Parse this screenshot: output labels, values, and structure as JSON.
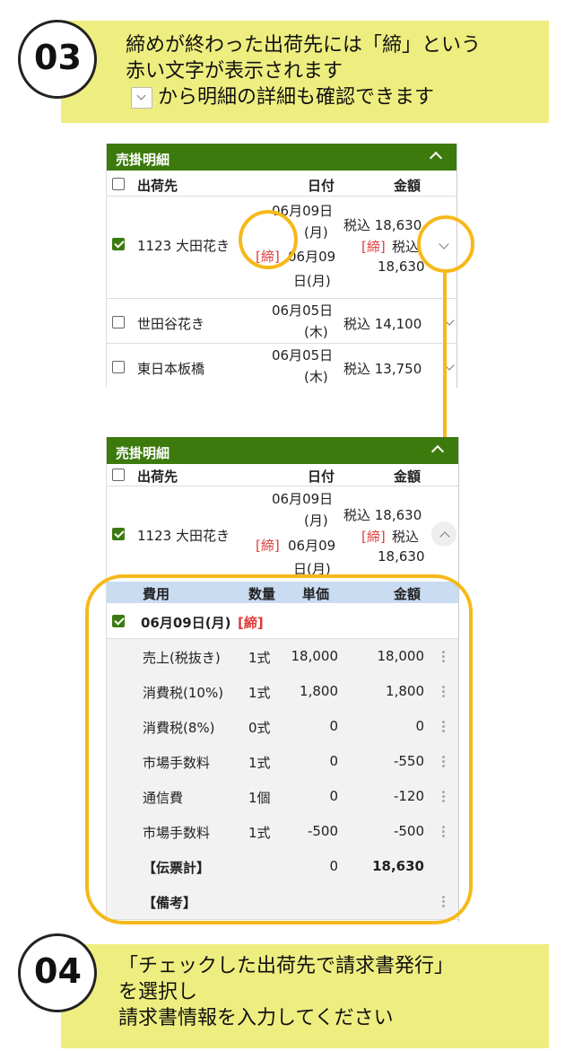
{
  "steps": {
    "step3": {
      "number": "03",
      "line1": "締めが終わった出荷先には「締」という",
      "line2": "赤い文字が表示されます",
      "line3": "から明細の詳細も確認できます"
    },
    "step4": {
      "number": "04",
      "line1": "「チェックした出荷先で請求書発行」",
      "line2": "を選択し",
      "line3": "請求書情報を入力してください"
    }
  },
  "panel": {
    "title": "売掛明細",
    "columns": {
      "destination": "出荷先",
      "date": "日付",
      "amount": "金額"
    },
    "rows": [
      {
        "name": "1123 大田花き",
        "date_line1": "06月09日",
        "date_line2": "(月)",
        "closed_tag": "[締]",
        "date_line3": "06月09",
        "date_line4": "日(月)",
        "amount_line1": "税込 18,630",
        "closed_tag2": "[締]",
        "amount_line2": "税込",
        "amount_line3": "18,630",
        "checked": true
      },
      {
        "name": "世田谷花き",
        "date_line1": "06月05日",
        "date_line2": "(木)",
        "amount_line1": "税込 14,100",
        "checked": false
      },
      {
        "name": "東日本板橋",
        "date_line1": "06月05日",
        "date_line2": "(木)",
        "amount_line1": "税込 13,750",
        "checked": false
      }
    ]
  },
  "detail": {
    "columns": {
      "expense": "費用",
      "qty": "数量",
      "unit_price": "単価",
      "amount": "金額"
    },
    "group_date": "06月09日(月)",
    "group_tag": "[締]",
    "items": [
      {
        "expense": "売上(税抜き)",
        "qty": "1式",
        "unit_price": "18,000",
        "amount": "18,000"
      },
      {
        "expense": "消費税(10%)",
        "qty": "1式",
        "unit_price": "1,800",
        "amount": "1,800"
      },
      {
        "expense": "消費税(8%)",
        "qty": "0式",
        "unit_price": "0",
        "amount": "0"
      },
      {
        "expense": "市場手数料",
        "qty": "1式",
        "unit_price": "0",
        "amount": "-550"
      },
      {
        "expense": "通信費",
        "qty": "1個",
        "unit_price": "0",
        "amount": "-120"
      },
      {
        "expense": "市場手数料",
        "qty": "1式",
        "unit_price": "-500",
        "amount": "-500"
      }
    ],
    "total_label": "【伝票計】",
    "total_unit_price": "0",
    "total_amount": "18,630",
    "remarks_label": "【備考】"
  },
  "colors": {
    "header_green": "#3d7a0d",
    "banner_yellow": "#eeee80",
    "highlight": "#f6b91a",
    "closed_red": "#e03b3b",
    "detail_header_blue": "#c9dcf2"
  }
}
